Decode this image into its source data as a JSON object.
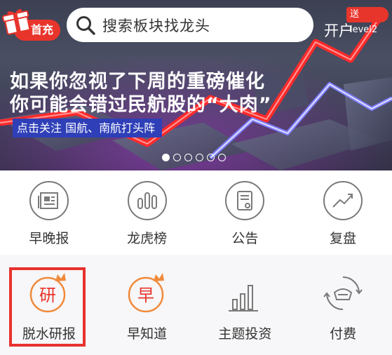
{
  "top_bar": {
    "recharge_label": "首充",
    "search_placeholder": "搜索板块找龙头",
    "open_account_label": "开户",
    "level2_badge": "送level2"
  },
  "banner": {
    "headline_line1": "如果你忽视了下周的重磅催化",
    "headline_line2": "你可能会错过民航股的“大肉”",
    "subline": "点击关注 国航、南航打头阵",
    "carousel_count": 6,
    "carousel_active": 0
  },
  "grid": {
    "row1": [
      {
        "label": "早晚报",
        "icon": "newspaper-icon"
      },
      {
        "label": "龙虎榜",
        "icon": "bar-chart-icon"
      },
      {
        "label": "公告",
        "icon": "document-icon"
      },
      {
        "label": "复盘",
        "icon": "trend-line-icon"
      }
    ],
    "row2": [
      {
        "label": "脱水研报",
        "icon": "research-crown-icon",
        "glyph": "研"
      },
      {
        "label": "早知道",
        "icon": "early-crown-icon",
        "glyph": "早"
      },
      {
        "label": "主题投资",
        "icon": "bar-growth-icon"
      },
      {
        "label": "付费",
        "icon": "gold-ingot-icon"
      }
    ]
  },
  "colors": {
    "accent_red": "#e8352c",
    "icon_gray": "#7a7a7a",
    "crown_orange": "#f08a3a",
    "subline_blue": "#2e3fb8"
  }
}
